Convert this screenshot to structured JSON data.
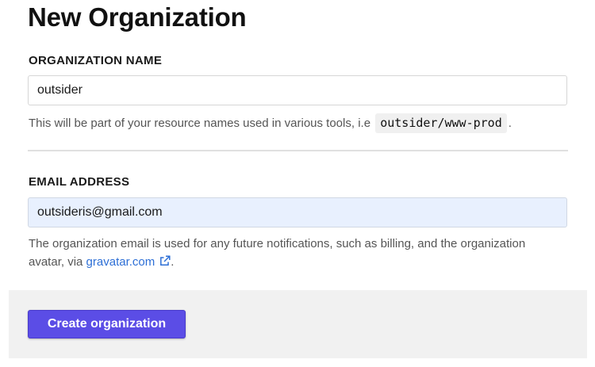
{
  "page": {
    "title": "New Organization"
  },
  "org_name": {
    "label": "ORGANIZATION NAME",
    "value": "outsider",
    "help_prefix": "This will be part of your resource names used in various tools, i.e",
    "help_code": "outsider/www-prod",
    "help_suffix": "."
  },
  "email": {
    "label": "EMAIL ADDRESS",
    "value": "outsideris@gmail.com",
    "help_prefix": "The organization email is used for any future notifications, such as billing, and the organization avatar, via",
    "link_text": "gravatar.com",
    "link_icon": "external-link-icon",
    "help_suffix": "."
  },
  "footer": {
    "create_button_label": "Create organization"
  },
  "colors": {
    "accent": "#5b4de6",
    "link": "#2d6fd6",
    "autofill_bg": "#e8f0fe",
    "footer_bg": "#f1f1f1"
  }
}
